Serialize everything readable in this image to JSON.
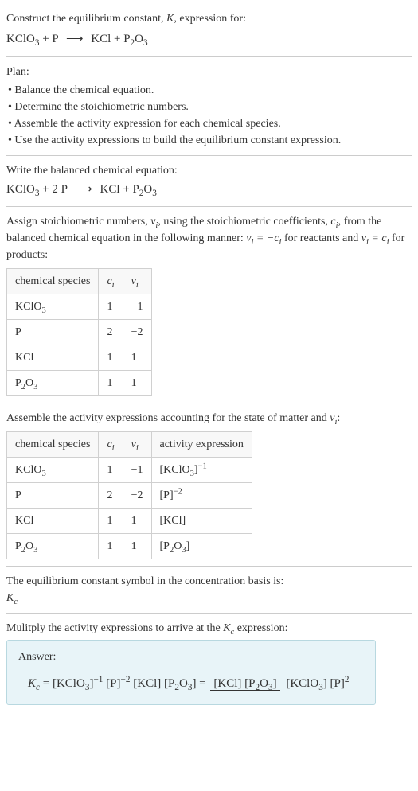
{
  "intro": {
    "prompt_line1": "Construct the equilibrium constant, ",
    "K": "K",
    "prompt_line1_end": ", expression for:",
    "eq_left": "KClO",
    "eq_left_sub": "3",
    "eq_plus": " + P ",
    "eq_arrow": "⟶",
    "eq_right": " KCl + P",
    "eq_right_sub1": "2",
    "eq_right_mid": "O",
    "eq_right_sub2": "3"
  },
  "plan": {
    "title": "Plan:",
    "items": [
      "• Balance the chemical equation.",
      "• Determine the stoichiometric numbers.",
      "• Assemble the activity expression for each chemical species.",
      "• Use the activity expressions to build the equilibrium constant expression."
    ]
  },
  "balanced": {
    "intro": "Write the balanced chemical equation:",
    "eq": "KClO₃ + 2 P ⟶ KCl + P₂O₃"
  },
  "stoich": {
    "intro_part1": "Assign stoichiometric numbers, ",
    "nu_i": "νᵢ",
    "intro_part2": ", using the stoichiometric coefficients, ",
    "c_i": "cᵢ",
    "intro_part3": ", from the balanced chemical equation in the following manner: ",
    "rel1": "νᵢ = −cᵢ",
    "intro_part4": " for reactants and ",
    "rel2": "νᵢ = cᵢ",
    "intro_part5": " for products:",
    "headers": [
      "chemical species",
      "cᵢ",
      "νᵢ"
    ],
    "rows": [
      {
        "species": "KClO₃",
        "c": "1",
        "nu": "−1"
      },
      {
        "species": "P",
        "c": "2",
        "nu": "−2"
      },
      {
        "species": "KCl",
        "c": "1",
        "nu": "1"
      },
      {
        "species": "P₂O₃",
        "c": "1",
        "nu": "1"
      }
    ]
  },
  "activity": {
    "intro_part1": "Assemble the activity expressions accounting for the state of matter and ",
    "nu_i": "νᵢ",
    "intro_part2": ":",
    "headers": [
      "chemical species",
      "cᵢ",
      "νᵢ",
      "activity expression"
    ],
    "rows": [
      {
        "species": "KClO₃",
        "c": "1",
        "nu": "−1",
        "expr": "[KClO₃]⁻¹"
      },
      {
        "species": "P",
        "c": "2",
        "nu": "−2",
        "expr": "[P]⁻²"
      },
      {
        "species": "KCl",
        "c": "1",
        "nu": "1",
        "expr": "[KCl]"
      },
      {
        "species": "P₂O₃",
        "c": "1",
        "nu": "1",
        "expr": "[P₂O₃]"
      }
    ]
  },
  "kc_symbol": {
    "intro": "The equilibrium constant symbol in the concentration basis is:",
    "symbol_K": "K",
    "symbol_c": "c"
  },
  "final": {
    "intro_part1": "Mulitply the activity expressions to arrive at the ",
    "K": "K",
    "c": "c",
    "intro_part2": " expression:",
    "answer_label": "Answer:",
    "formula_lhs": "Kc = [KClO₃]⁻¹ [P]⁻² [KCl] [P₂O₃] = ",
    "formula_num": "[KCl] [P₂O₃]",
    "formula_den": "[KClO₃] [P]²"
  }
}
